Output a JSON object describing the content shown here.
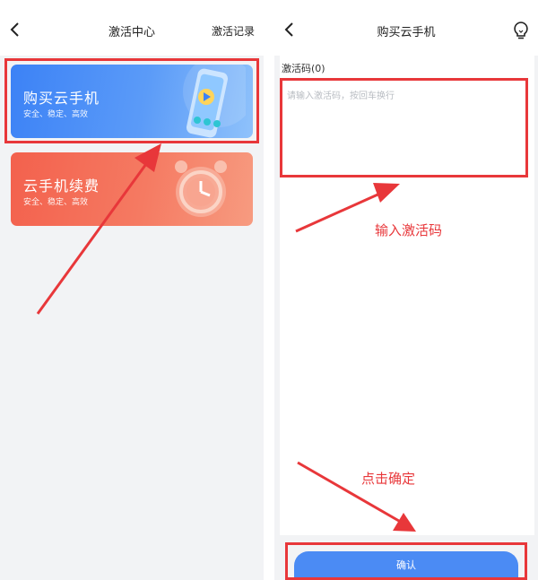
{
  "left": {
    "title": "激活中心",
    "right_link": "激活记录",
    "cards": [
      {
        "title": "购买云手机",
        "subtitle": "安全、稳定、高效"
      },
      {
        "title": "云手机续费",
        "subtitle": "安全、稳定、高效"
      }
    ]
  },
  "right": {
    "title": "购买云手机",
    "code_label": "激活码(0)",
    "code_placeholder": "请输入激活码，按回车换行",
    "code_value": "",
    "confirm_label": "确认"
  },
  "annotations": {
    "input_hint": "输入激活码",
    "click_hint": "点击确定"
  },
  "colors": {
    "highlight": "#e8373a",
    "primary": "#4b8bf4",
    "card_blue": "#3c82f6",
    "card_red": "#f3614d"
  },
  "icons": {
    "back": "chevron-left-icon",
    "bulb": "lightbulb-icon"
  }
}
